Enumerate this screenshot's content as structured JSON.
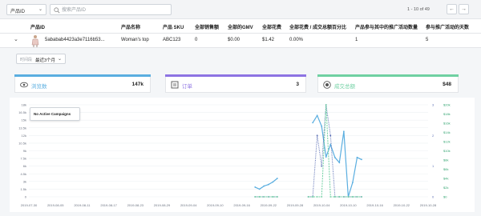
{
  "toolbar": {
    "filter_select": "产品ID",
    "search_placeholder": "搜索产品ID",
    "pager_text": "1 - 10 of 49"
  },
  "table": {
    "columns": [
      "产品ID",
      "产品名称",
      "产品 SKU",
      "全部销售额",
      "全部的GMV",
      "全部花费",
      "全部花费 / 成交总额百分比",
      "产品参与其中的推广活动数量",
      "参与推广活动的天数"
    ],
    "row": {
      "product_id": "5ababab4423a3e7116b53...",
      "name": "Woman's top",
      "sku": "ABC123",
      "sales": "0",
      "gmv": "$0.00",
      "spend": "$1.42",
      "spend_pct": "0.00%",
      "campaigns": "1",
      "days": "5"
    }
  },
  "detail": {
    "range_label": "时间段",
    "range_value": "最近3个月",
    "cards": [
      {
        "label": "浏览数",
        "value": "147k",
        "color": "#5aaee0",
        "icon": "eye-icon"
      },
      {
        "label": "订单",
        "value": "3",
        "color": "#8d73e3",
        "icon": "receipt-icon"
      },
      {
        "label": "成交总额",
        "value": "$48",
        "color": "#6fd0a2",
        "icon": "coin-icon"
      }
    ],
    "tooltip": "No Active Campaigns"
  },
  "chart_data": {
    "type": "line",
    "x": [
      "2019-07-30",
      "2019-08-05",
      "2019-08-11",
      "2019-08-17",
      "2019-08-23",
      "2019-08-29",
      "2019-09-04",
      "2019-09-10",
      "2019-09-16",
      "2019-09-22",
      "2019-09-28",
      "2019-10-04",
      "2019-10-10",
      "2019-10-16",
      "2019-10-22",
      "2019-10-28"
    ],
    "y_left": {
      "ticks": [
        "0",
        "1.5k",
        "3k",
        "4.5k",
        "6k",
        "7.5k",
        "9k",
        "10.5k",
        "12k",
        "13.5k",
        "15k",
        "16.5k",
        "18k"
      ],
      "ylim": [
        0,
        18000
      ]
    },
    "y_right_orders": {
      "ticks": [
        "0",
        "1",
        "2",
        "3"
      ],
      "ylim": [
        0,
        3
      ]
    },
    "y_right_revenue": {
      "ticks": [
        "$0",
        "$2k",
        "$4k",
        "$6k",
        "$8k",
        "$10k",
        "$12k",
        "$14k",
        "$16k",
        "$18k",
        "$20k"
      ],
      "ylim": [
        0,
        20000
      ]
    },
    "series": [
      {
        "name": "浏览数",
        "color": "#5aaee0",
        "style": "solid",
        "points": [
          [
            "2019-09-19",
            1900
          ],
          [
            "2019-09-20",
            1500
          ],
          [
            "2019-09-21",
            2100
          ],
          [
            "2019-09-22",
            2400
          ],
          [
            "2019-09-23",
            2900
          ],
          [
            "2019-09-24",
            3600
          ],
          [
            "2019-10-02",
            14500
          ],
          [
            "2019-10-03",
            15900
          ],
          [
            "2019-10-04",
            13800
          ],
          [
            "2019-10-05",
            7800
          ],
          [
            "2019-10-06",
            10200
          ],
          [
            "2019-10-07",
            7700
          ],
          [
            "2019-10-08",
            6700
          ],
          [
            "2019-10-09",
            12800
          ],
          [
            "2019-10-10",
            0
          ],
          [
            "2019-10-11",
            2800
          ],
          [
            "2019-10-12",
            7700
          ],
          [
            "2019-10-13",
            7300
          ]
        ]
      },
      {
        "name": "订单",
        "color": "#5b6fb5",
        "style": "dotted",
        "points": [
          [
            "2019-09-19",
            0
          ],
          [
            "2019-09-20",
            0
          ],
          [
            "2019-09-21",
            0
          ],
          [
            "2019-09-22",
            0
          ],
          [
            "2019-09-23",
            0
          ],
          [
            "2019-09-24",
            0
          ],
          [
            "2019-10-01",
            0
          ],
          [
            "2019-10-02",
            0
          ],
          [
            "2019-10-03",
            2
          ],
          [
            "2019-10-04",
            1
          ],
          [
            "2019-10-05",
            3
          ],
          [
            "2019-10-06",
            2
          ],
          [
            "2019-10-07",
            0
          ],
          [
            "2019-10-08",
            0
          ],
          [
            "2019-10-09",
            0
          ],
          [
            "2019-10-10",
            0
          ],
          [
            "2019-10-11",
            0
          ],
          [
            "2019-10-12",
            0
          ],
          [
            "2019-10-13",
            0
          ]
        ]
      },
      {
        "name": "成交总额",
        "color": "#6fd0a2",
        "style": "dashed",
        "points": [
          [
            "2019-09-19",
            0
          ],
          [
            "2019-09-20",
            0
          ],
          [
            "2019-09-21",
            0
          ],
          [
            "2019-09-22",
            0
          ],
          [
            "2019-09-23",
            0
          ],
          [
            "2019-09-24",
            0
          ],
          [
            "2019-10-01",
            0
          ],
          [
            "2019-10-02",
            0
          ],
          [
            "2019-10-03",
            0
          ],
          [
            "2019-10-04",
            0
          ],
          [
            "2019-10-05",
            20000
          ],
          [
            "2019-10-06",
            0
          ],
          [
            "2019-10-07",
            0
          ],
          [
            "2019-10-08",
            0
          ],
          [
            "2019-10-09",
            0
          ],
          [
            "2019-10-10",
            0
          ],
          [
            "2019-10-11",
            0
          ],
          [
            "2019-10-12",
            0
          ],
          [
            "2019-10-13",
            0
          ]
        ]
      }
    ],
    "grid": true,
    "legend": "none"
  }
}
